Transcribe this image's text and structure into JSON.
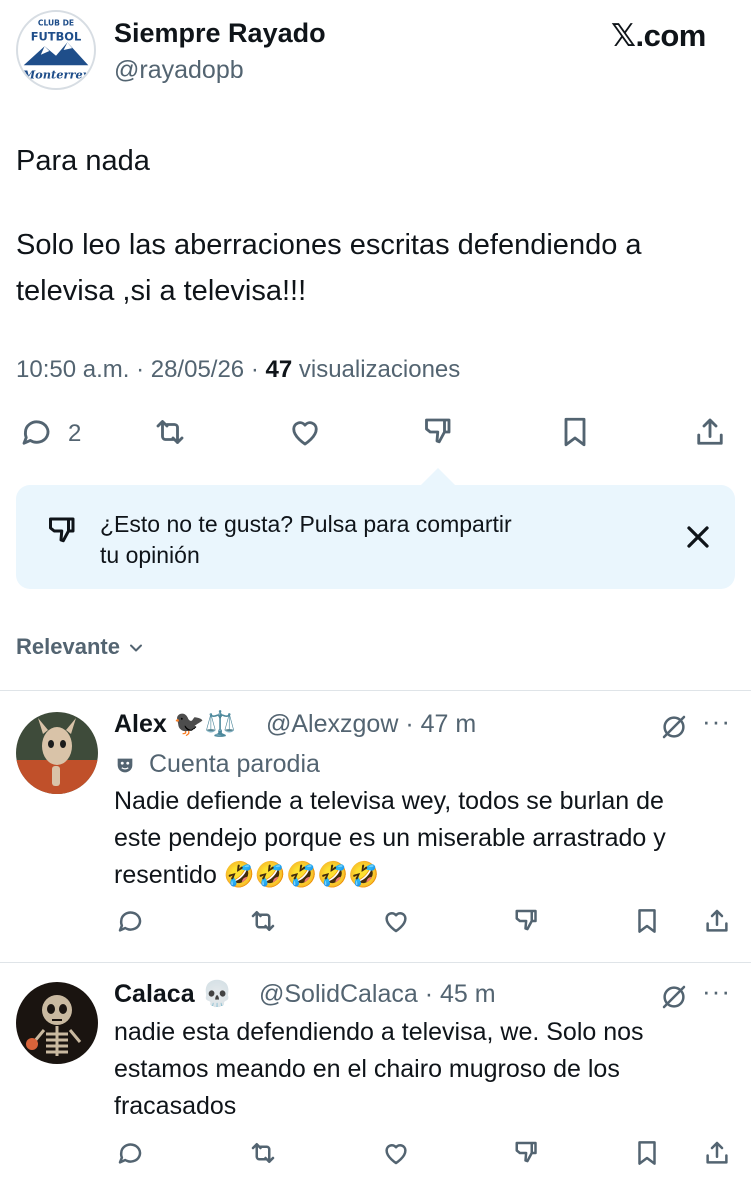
{
  "tweet": {
    "author_name": "Siempre Rayado",
    "author_handle": "@rayadopb",
    "avatar_text": [
      "CLUB DE",
      "FUTBOL",
      "Monterrey"
    ],
    "site_logo": "𝕏.com",
    "text_line1": "Para nada",
    "text_line2": "Solo leo las aberraciones escritas defendiendo a",
    "text_line3": "televisa ,si a televisa!!!",
    "time": "10:50 a.m.",
    "date": "28/05/26",
    "views_count": "47",
    "views_label": "visualizaciones",
    "reply_count": "2"
  },
  "icons": [
    "reply-icon",
    "retweet-icon",
    "like-icon",
    "dislike-icon",
    "bookmark-icon",
    "share-icon",
    "close-icon",
    "chevron-down-icon",
    "grok-icon",
    "more-icon",
    "parody-mask-icon"
  ],
  "dislike_prompt": {
    "line1": "¿Esto no te gusta? Pulsa para compartir",
    "line2": "tu opinión"
  },
  "sort": {
    "label": "Relevante"
  },
  "replies": [
    {
      "name": "Alex",
      "name_emoji": "🐦‍⬛⚖️",
      "handle": "@Alexzgow",
      "time": "47 m",
      "badge": "Cuenta parodia",
      "lines": [
        "Nadie defiende a televisa wey, todos se burlan de",
        "este pendejo porque es un miserable arrastrado y",
        "resentido  🤣🤣🤣🤣🤣"
      ]
    },
    {
      "name": "Calaca",
      "name_emoji": "💀",
      "handle": "@SolidCalaca",
      "time": "45 m",
      "lines": [
        "nadie esta defendiendo a televisa, we. Solo nos",
        "estamos meando en el chairo mugroso de los",
        "fracasados"
      ]
    }
  ],
  "colors": {
    "text": "#0f1419",
    "secondary": "#536471",
    "prompt_bg": "#eaf6fd",
    "divider": "#dfe4e8"
  }
}
